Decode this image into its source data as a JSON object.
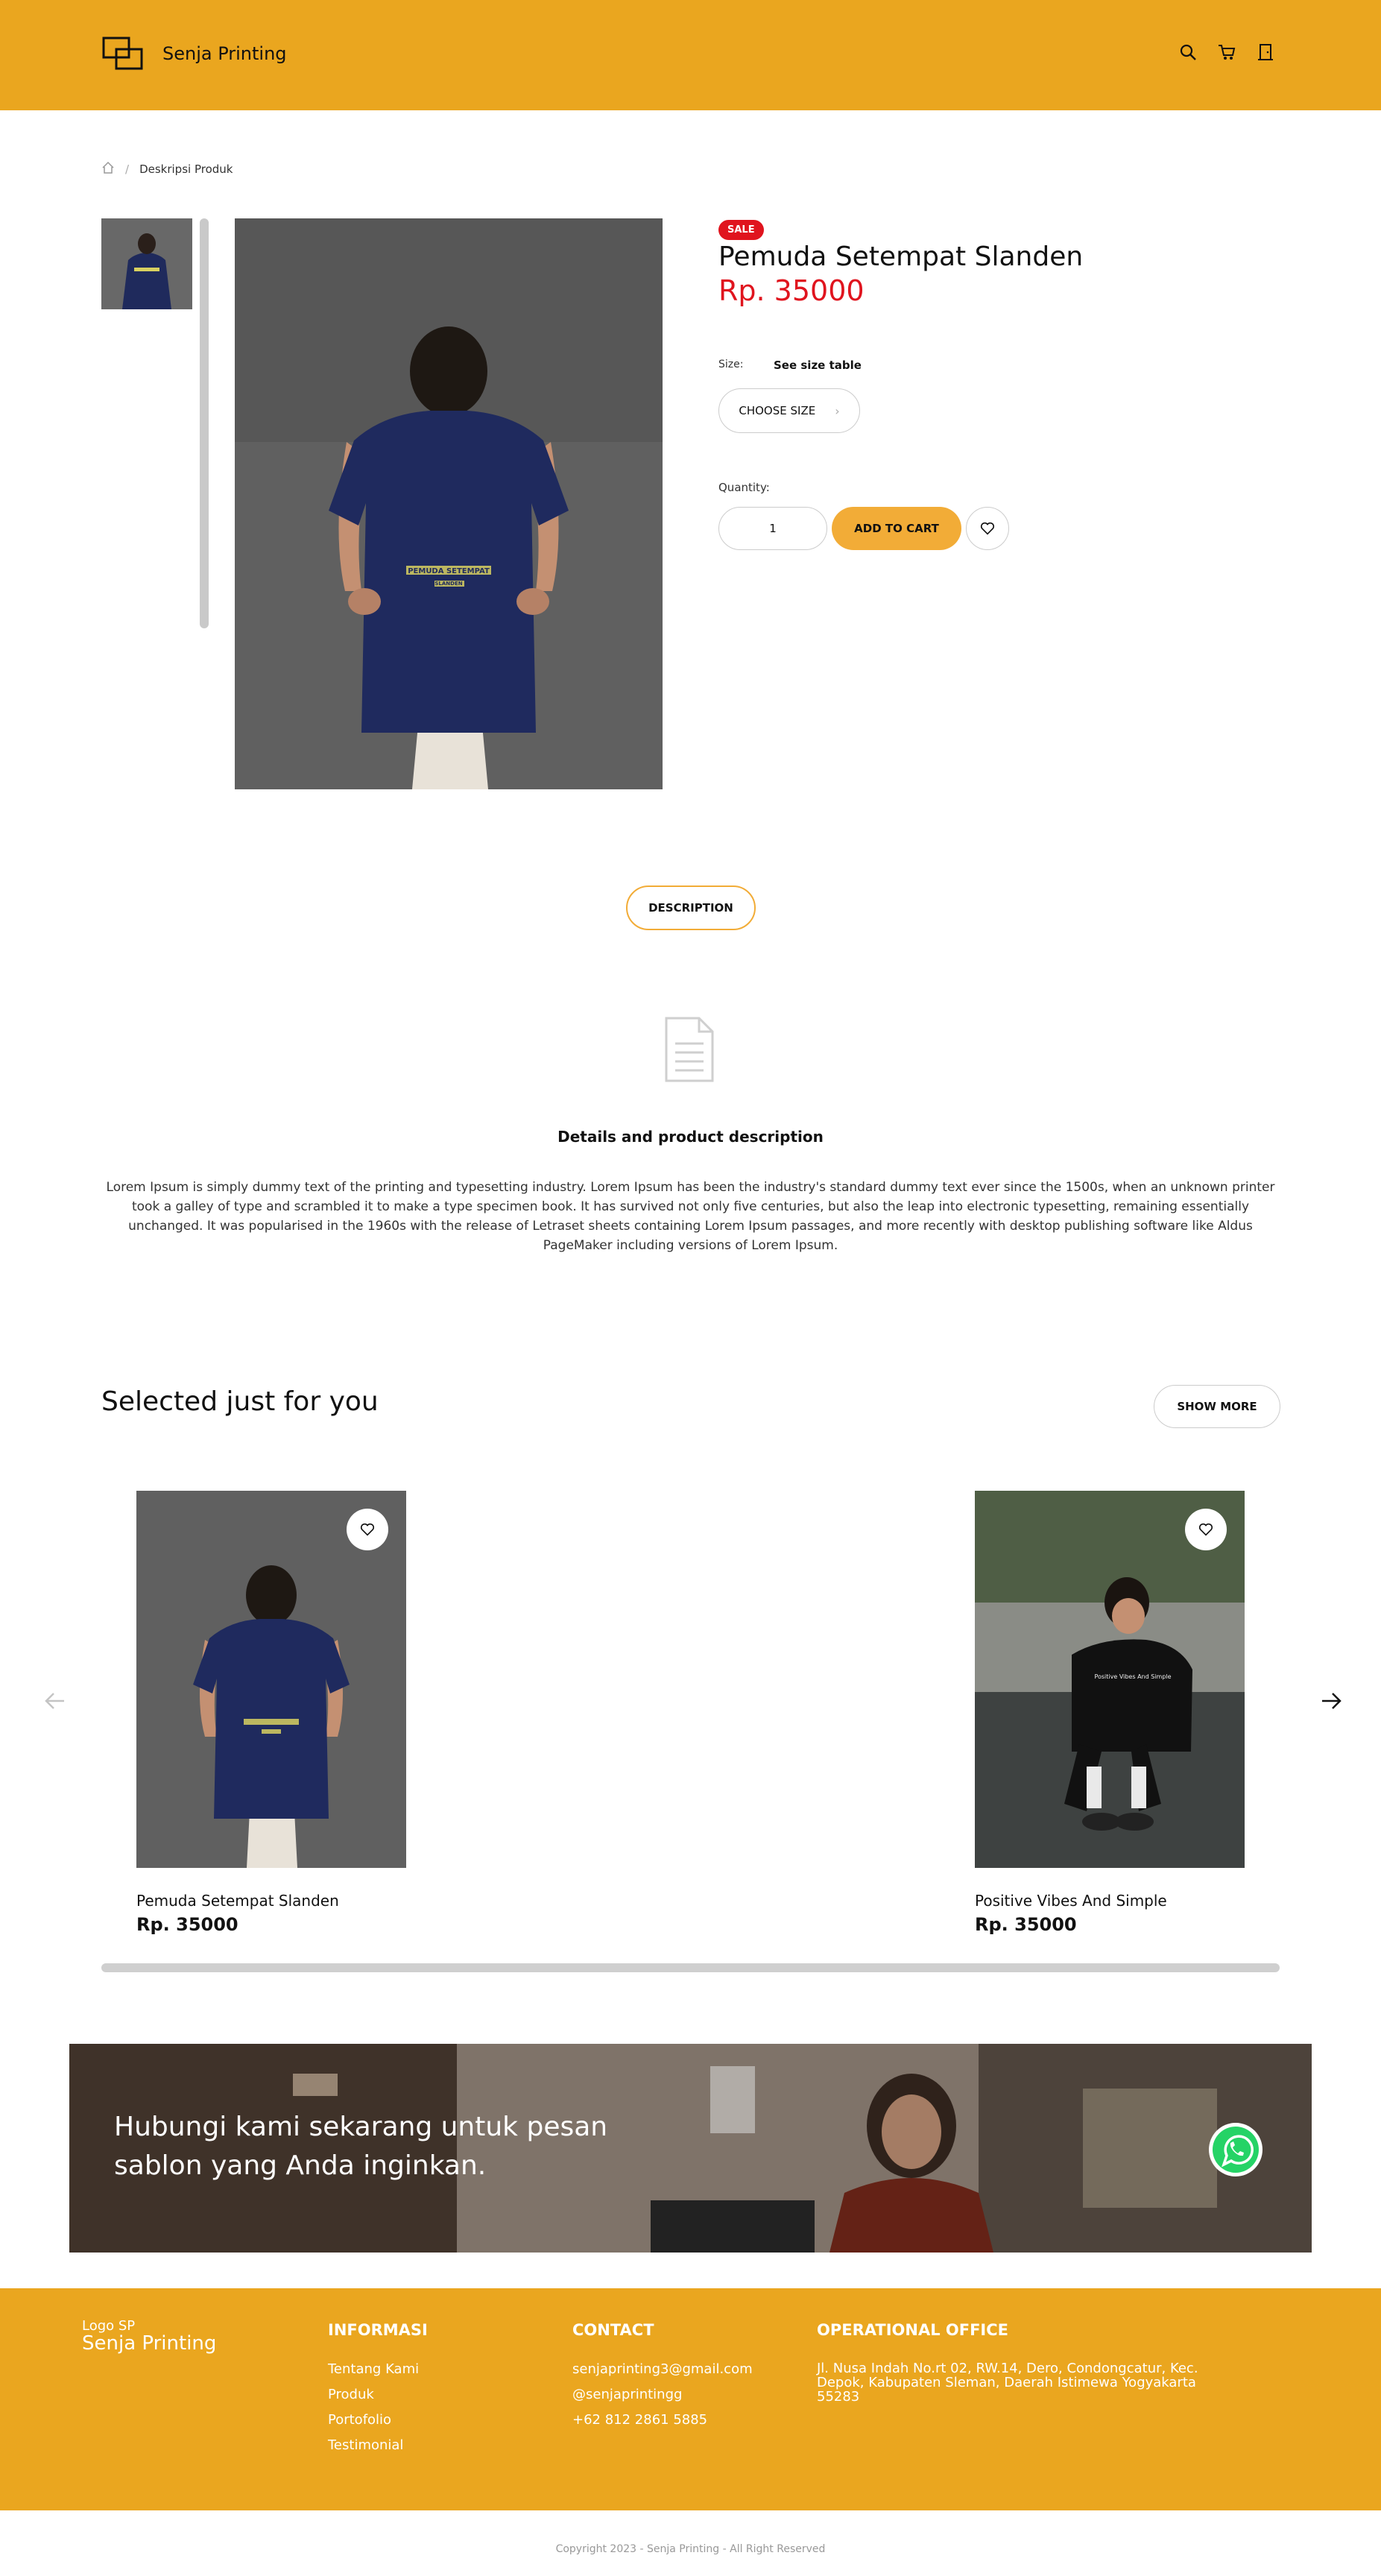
{
  "header": {
    "brand": "Senja Printing",
    "icons": [
      "search-icon",
      "cart-icon",
      "door-icon"
    ]
  },
  "breadcrumb": {
    "home_icon": "home-icon",
    "current": "Deskripsi Produk"
  },
  "product": {
    "badge": "SALE",
    "title": "Pemuda Setempat Slanden",
    "price": "Rp. 35000",
    "size_label": "Size:",
    "size_table": "See size table",
    "choose_size": "CHOOSE SIZE",
    "quantity_label": "Quantity:",
    "quantity": "1",
    "add_to_cart": "ADD TO CART",
    "shirt_print": "PEMUDA SETEMPAT",
    "shirt_print_2": "SLANDEN"
  },
  "description": {
    "tab": "DESCRIPTION",
    "heading": "Details and product description",
    "text": "Lorem Ipsum is simply dummy text of the printing and typesetting industry. Lorem Ipsum has been the industry's standard dummy text ever since the 1500s, when an unknown printer took a galley of type and scrambled it to make a type specimen book. It has survived not only five centuries, but also the leap into electronic typesetting, remaining essentially unchanged. It was popularised in the 1960s with the release of Letraset sheets containing Lorem Ipsum passages, and more recently with desktop publishing software like Aldus PageMaker including versions of Lorem Ipsum."
  },
  "selected": {
    "title": "Selected just for you",
    "show_more": "SHOW MORE",
    "items": [
      {
        "name": "Pemuda Setempat Slanden",
        "price": "Rp. 35000"
      },
      {
        "name": "Positive Vibes And Simple",
        "price": "Rp. 35000",
        "shirt_print": "Positive Vibes And Simple"
      }
    ]
  },
  "banner": {
    "line1": "Hubungi kami sekarang untuk pesan",
    "line2": "sablon yang Anda inginkan."
  },
  "footer": {
    "logo_alt": "Logo SP",
    "logo_text": "Senja Printing",
    "informasi": {
      "title": "INFORMASI",
      "items": [
        "Tentang Kami",
        "Produk",
        "Portofolio",
        "Testimonial"
      ]
    },
    "contact": {
      "title": "CONTACT",
      "items": [
        "senjaprinting3@gmail.com",
        "@senjaprintingg",
        "+62 812 2861 5885"
      ]
    },
    "office": {
      "title": "OPERATIONAL OFFICE",
      "address": "Jl. Nusa Indah No.rt 02, RW.14, Dero, Condongcatur, Kec. Depok, Kabupaten Sleman, Daerah Istimewa Yogyakarta 55283"
    },
    "copyright": "Copyright 2023 - Senja Printing - All Right Reserved"
  },
  "colors": {
    "brand": "#EAA61F",
    "accent": "#F2AC37",
    "sale": "#E0141E"
  }
}
